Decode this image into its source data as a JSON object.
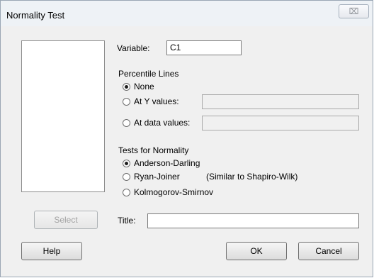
{
  "window": {
    "title": "Normality Test",
    "close_glyph": "⌧"
  },
  "variable": {
    "label": "Variable:",
    "value": "C1"
  },
  "percentile": {
    "heading": "Percentile Lines",
    "options": [
      "None",
      "At Y values:",
      "At data values:"
    ],
    "selected": "None"
  },
  "tests": {
    "heading": "Tests for Normality",
    "options": [
      "Anderson-Darling",
      "Ryan-Joiner",
      "Kolmogorov-Smirnov"
    ],
    "ryan_note": "(Similar to Shapiro-Wilk)",
    "selected": "Anderson-Darling"
  },
  "title_field": {
    "label": "Title:",
    "value": ""
  },
  "buttons": {
    "select": "Select",
    "help": "Help",
    "ok": "OK",
    "cancel": "Cancel"
  }
}
